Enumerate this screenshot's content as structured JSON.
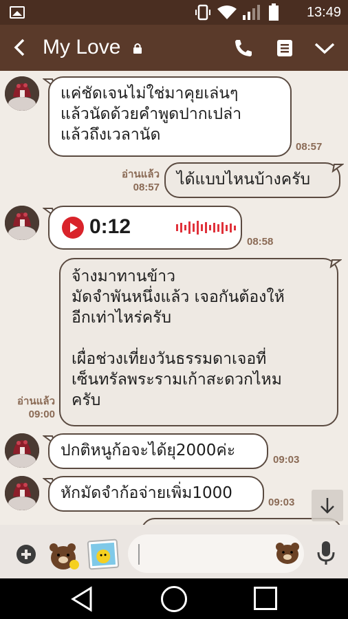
{
  "status_bar": {
    "time": "13:49"
  },
  "header": {
    "title": "My Love"
  },
  "messages": [
    {
      "sender": "other",
      "lines": [
        "แค่ชัดเจนไม่ใช่มาคุยเล่นๆ",
        "แล้วนัดด้วยคำพูดปากเปล่า",
        "แล้วถึงเวลานัด"
      ],
      "time": "08:57"
    },
    {
      "sender": "me",
      "lines": [
        "ได้แบบไหนบ้างครับ"
      ],
      "read": "อ่านแล้ว",
      "time": "08:57"
    },
    {
      "sender": "other",
      "type": "voice",
      "duration": "0:12",
      "time": "08:58"
    },
    {
      "sender": "me",
      "lines": [
        "จ้างมาทานข้าว",
        "มัดจำพันหนึ่งแล้ว เจอกันต้องให้",
        "อีกเท่าไหร่ครับ",
        "",
        "เผื่อช่วงเที่ยงวันธรรมดาเจอที่",
        "เซ็นทรัลพระรามเก้าสะดวกไหม",
        "ครับ"
      ],
      "read": "อ่านแล้ว",
      "time": "09:00"
    },
    {
      "sender": "other",
      "lines": [
        "ปกติหนูก้อจะได้ยุ2000ค่ะ"
      ],
      "time": "09:03"
    },
    {
      "sender": "other",
      "lines": [
        "หักมัดจำก้อจ่ายเพิ่ม1000"
      ],
      "time": "09:03"
    }
  ],
  "input": {
    "value": "",
    "placeholder": ""
  },
  "colors": {
    "header": "#5a3a2a",
    "status_bar": "#4a2e21",
    "background": "#f1ece6",
    "voice_accent": "#d9232a",
    "meta": "#8a6a55"
  }
}
